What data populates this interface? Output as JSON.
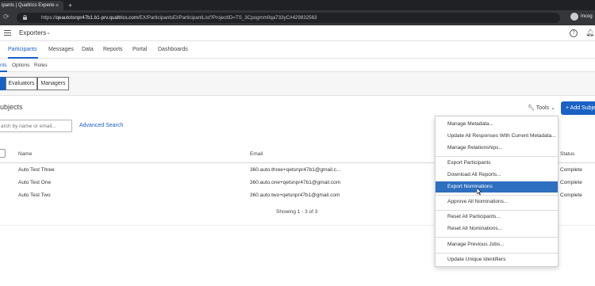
{
  "browser": {
    "tab_title": "ipants | Qualtrics Experie",
    "tab_close": "×",
    "new_tab": "+",
    "url_prefix": "https://",
    "url_host": "qeautotsnpr47b1.b1-prv.qualtrics.com",
    "url_path": "/EX/ParticipantsEI/ParticipantList?ProjectID=TS_3Cpogmm0qa733yC#429832563",
    "profile_name": "Incog"
  },
  "header": {
    "project": "Exporters",
    "help": "?"
  },
  "nav_tabs": [
    {
      "label": "Participants",
      "active": true
    },
    {
      "label": "Messages",
      "active": false
    },
    {
      "label": "Data",
      "active": false
    },
    {
      "label": "Reports",
      "active": false
    },
    {
      "label": "Portal",
      "active": false
    },
    {
      "label": "Dashboards",
      "active": false
    }
  ],
  "sub_tabs": [
    {
      "label": "nts",
      "active": true
    },
    {
      "label": "Options",
      "active": false
    },
    {
      "label": "Roles",
      "active": false
    }
  ],
  "filters": [
    {
      "label": "",
      "active": true
    },
    {
      "label": "Evaluators",
      "active": false
    },
    {
      "label": "Managers",
      "active": false
    }
  ],
  "section": {
    "title": "ubjects",
    "tools_label": "Tools",
    "add_label": "+ Add Subje"
  },
  "search": {
    "placeholder": "arch by name or email...",
    "advanced": "Advanced Search"
  },
  "table": {
    "columns": [
      "Name",
      "Email",
      "Status"
    ],
    "rows": [
      {
        "name": "Auto Test Three",
        "email": "360.auto.three+qetsnpr47b1@gmail.c...",
        "status": "Complete"
      },
      {
        "name": "Auto Test One",
        "email": "360.auto.one+qetsnpr47b1@gmail.com",
        "status": "Complete"
      },
      {
        "name": "Auto Test Two",
        "email": "360.auto.two+qetsnpr47b1@gmail.com",
        "status": "Complete"
      }
    ],
    "showing": "Showing 1 - 3 of 3"
  },
  "tools_menu": {
    "items": [
      {
        "label": "Manage Metadata...",
        "highlighted": false
      },
      {
        "label": "Update All Responses With Current Metadata...",
        "highlighted": false
      },
      {
        "label": "Manage Relationships...",
        "highlighted": false
      },
      {
        "label": "Export Participants",
        "highlighted": false
      },
      {
        "label": "Download All Reports...",
        "highlighted": false
      },
      {
        "label": "Export Nominations",
        "highlighted": true
      },
      {
        "label": "Approve All Nominations...",
        "highlighted": false
      },
      {
        "label": "Reset All Participants...",
        "highlighted": false
      },
      {
        "label": "Reset All Nominations...",
        "highlighted": false
      },
      {
        "label": "Manage Previous Jobs...",
        "highlighted": false
      },
      {
        "label": "Update Unique Identifiers",
        "highlighted": false
      }
    ]
  },
  "colors": {
    "accent": "#1a61c4",
    "menu_highlight": "#2f6fbf"
  }
}
